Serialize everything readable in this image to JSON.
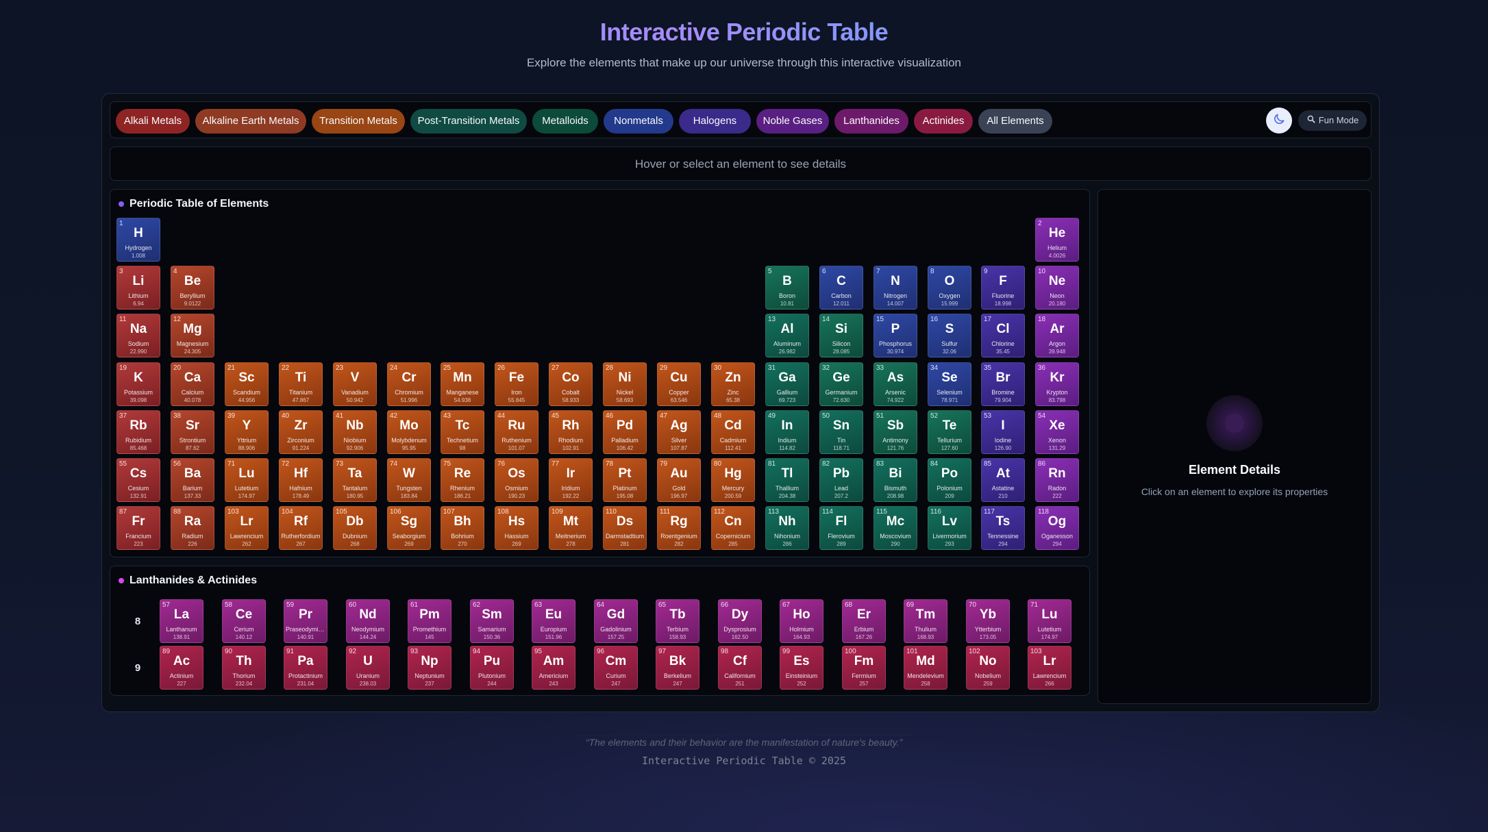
{
  "header": {
    "title": "Interactive Periodic Table",
    "subtitle": "Explore the elements that make up our universe through this interactive visualization"
  },
  "filters": [
    {
      "label": "Alkali Metals",
      "color": "#8f2424"
    },
    {
      "label": "Alkaline Earth Metals",
      "color": "#8f3a23"
    },
    {
      "label": "Transition Metals",
      "color": "#9a4514"
    },
    {
      "label": "Post-Transition Metals",
      "color": "#0f4a43"
    },
    {
      "label": "Metalloids",
      "color": "#0c4a3a"
    },
    {
      "label": "Nonmetals",
      "color": "#233a8c"
    },
    {
      "label": "Halogens",
      "color": "#3a2a8a"
    },
    {
      "label": "Noble Gases",
      "color": "#5a1f82"
    },
    {
      "label": "Lanthanides",
      "color": "#6e1a6a"
    },
    {
      "label": "Actinides",
      "color": "#8a1a40"
    },
    {
      "label": "All Elements",
      "color": "#394355"
    }
  ],
  "toolbar": {
    "theme_icon": "moon-icon",
    "fun_mode_label": "Fun Mode",
    "fun_mode_icon": "magnifier-icon"
  },
  "hover_hint": "Hover or select an element to see details",
  "main_table": {
    "title": "Periodic Table of Elements",
    "dot_color": "#8b5cf6"
  },
  "la_table": {
    "title": "Lanthanides & Actinides",
    "dot_color": "#d946ef",
    "row_labels": [
      "8",
      "9"
    ]
  },
  "details": {
    "title": "Element Details",
    "subtitle": "Click on an element to explore its properties"
  },
  "footer": {
    "quote": "“The elements and their behavior are the manifestation of nature's beauty.”",
    "copyright": "Interactive Periodic Table © 2025"
  },
  "elements": [
    {
      "n": 1,
      "s": "H",
      "name": "Hydrogen",
      "m": "1.008",
      "c": "nonmetal",
      "r": 1,
      "col": 1
    },
    {
      "n": 2,
      "s": "He",
      "name": "Helium",
      "m": "4.0026",
      "c": "noble",
      "r": 1,
      "col": 18
    },
    {
      "n": 3,
      "s": "Li",
      "name": "Lithium",
      "m": "6.94",
      "c": "alkali",
      "r": 2,
      "col": 1
    },
    {
      "n": 4,
      "s": "Be",
      "name": "Beryllium",
      "m": "9.0122",
      "c": "alkaline",
      "r": 2,
      "col": 2
    },
    {
      "n": 5,
      "s": "B",
      "name": "Boron",
      "m": "10.81",
      "c": "metalloid",
      "r": 2,
      "col": 13
    },
    {
      "n": 6,
      "s": "C",
      "name": "Carbon",
      "m": "12.011",
      "c": "nonmetal",
      "r": 2,
      "col": 14
    },
    {
      "n": 7,
      "s": "N",
      "name": "Nitrogen",
      "m": "14.007",
      "c": "nonmetal",
      "r": 2,
      "col": 15
    },
    {
      "n": 8,
      "s": "O",
      "name": "Oxygen",
      "m": "15.999",
      "c": "nonmetal",
      "r": 2,
      "col": 16
    },
    {
      "n": 9,
      "s": "F",
      "name": "Fluorine",
      "m": "18.998",
      "c": "halogen",
      "r": 2,
      "col": 17
    },
    {
      "n": 10,
      "s": "Ne",
      "name": "Neon",
      "m": "20.180",
      "c": "noble",
      "r": 2,
      "col": 18
    },
    {
      "n": 11,
      "s": "Na",
      "name": "Sodium",
      "m": "22.990",
      "c": "alkali",
      "r": 3,
      "col": 1
    },
    {
      "n": 12,
      "s": "Mg",
      "name": "Magnesium",
      "m": "24.305",
      "c": "alkaline",
      "r": 3,
      "col": 2
    },
    {
      "n": 13,
      "s": "Al",
      "name": "Aluminum",
      "m": "26.982",
      "c": "post",
      "r": 3,
      "col": 13
    },
    {
      "n": 14,
      "s": "Si",
      "name": "Silicon",
      "m": "28.085",
      "c": "metalloid",
      "r": 3,
      "col": 14
    },
    {
      "n": 15,
      "s": "P",
      "name": "Phosphorus",
      "m": "30.974",
      "c": "nonmetal",
      "r": 3,
      "col": 15
    },
    {
      "n": 16,
      "s": "S",
      "name": "Sulfur",
      "m": "32.06",
      "c": "nonmetal",
      "r": 3,
      "col": 16
    },
    {
      "n": 17,
      "s": "Cl",
      "name": "Chlorine",
      "m": "35.45",
      "c": "halogen",
      "r": 3,
      "col": 17
    },
    {
      "n": 18,
      "s": "Ar",
      "name": "Argon",
      "m": "39.948",
      "c": "noble",
      "r": 3,
      "col": 18
    },
    {
      "n": 19,
      "s": "K",
      "name": "Potassium",
      "m": "39.098",
      "c": "alkali",
      "r": 4,
      "col": 1
    },
    {
      "n": 20,
      "s": "Ca",
      "name": "Calcium",
      "m": "40.078",
      "c": "alkaline",
      "r": 4,
      "col": 2
    },
    {
      "n": 21,
      "s": "Sc",
      "name": "Scandium",
      "m": "44.956",
      "c": "transition",
      "r": 4,
      "col": 3
    },
    {
      "n": 22,
      "s": "Ti",
      "name": "Titanium",
      "m": "47.867",
      "c": "transition",
      "r": 4,
      "col": 4
    },
    {
      "n": 23,
      "s": "V",
      "name": "Vanadium",
      "m": "50.942",
      "c": "transition",
      "r": 4,
      "col": 5
    },
    {
      "n": 24,
      "s": "Cr",
      "name": "Chromium",
      "m": "51.996",
      "c": "transition",
      "r": 4,
      "col": 6
    },
    {
      "n": 25,
      "s": "Mn",
      "name": "Manganese",
      "m": "54.938",
      "c": "transition",
      "r": 4,
      "col": 7
    },
    {
      "n": 26,
      "s": "Fe",
      "name": "Iron",
      "m": "55.845",
      "c": "transition",
      "r": 4,
      "col": 8
    },
    {
      "n": 27,
      "s": "Co",
      "name": "Cobalt",
      "m": "58.933",
      "c": "transition",
      "r": 4,
      "col": 9
    },
    {
      "n": 28,
      "s": "Ni",
      "name": "Nickel",
      "m": "58.693",
      "c": "transition",
      "r": 4,
      "col": 10
    },
    {
      "n": 29,
      "s": "Cu",
      "name": "Copper",
      "m": "63.546",
      "c": "transition",
      "r": 4,
      "col": 11
    },
    {
      "n": 30,
      "s": "Zn",
      "name": "Zinc",
      "m": "65.38",
      "c": "transition",
      "r": 4,
      "col": 12
    },
    {
      "n": 31,
      "s": "Ga",
      "name": "Gallium",
      "m": "69.723",
      "c": "post",
      "r": 4,
      "col": 13
    },
    {
      "n": 32,
      "s": "Ge",
      "name": "Germanium",
      "m": "72.630",
      "c": "metalloid",
      "r": 4,
      "col": 14
    },
    {
      "n": 33,
      "s": "As",
      "name": "Arsenic",
      "m": "74.922",
      "c": "metalloid",
      "r": 4,
      "col": 15
    },
    {
      "n": 34,
      "s": "Se",
      "name": "Selenium",
      "m": "78.971",
      "c": "nonmetal",
      "r": 4,
      "col": 16
    },
    {
      "n": 35,
      "s": "Br",
      "name": "Bromine",
      "m": "79.904",
      "c": "halogen",
      "r": 4,
      "col": 17
    },
    {
      "n": 36,
      "s": "Kr",
      "name": "Krypton",
      "m": "83.798",
      "c": "noble",
      "r": 4,
      "col": 18
    },
    {
      "n": 37,
      "s": "Rb",
      "name": "Rubidium",
      "m": "85.468",
      "c": "alkali",
      "r": 5,
      "col": 1
    },
    {
      "n": 38,
      "s": "Sr",
      "name": "Strontium",
      "m": "87.62",
      "c": "alkaline",
      "r": 5,
      "col": 2
    },
    {
      "n": 39,
      "s": "Y",
      "name": "Yttrium",
      "m": "88.906",
      "c": "transition",
      "r": 5,
      "col": 3
    },
    {
      "n": 40,
      "s": "Zr",
      "name": "Zirconium",
      "m": "91.224",
      "c": "transition",
      "r": 5,
      "col": 4
    },
    {
      "n": 41,
      "s": "Nb",
      "name": "Niobium",
      "m": "92.906",
      "c": "transition",
      "r": 5,
      "col": 5
    },
    {
      "n": 42,
      "s": "Mo",
      "name": "Molybdenum",
      "m": "95.95",
      "c": "transition",
      "r": 5,
      "col": 6
    },
    {
      "n": 43,
      "s": "Tc",
      "name": "Technetium",
      "m": "98",
      "c": "transition",
      "r": 5,
      "col": 7
    },
    {
      "n": 44,
      "s": "Ru",
      "name": "Ruthenium",
      "m": "101.07",
      "c": "transition",
      "r": 5,
      "col": 8
    },
    {
      "n": 45,
      "s": "Rh",
      "name": "Rhodium",
      "m": "102.91",
      "c": "transition",
      "r": 5,
      "col": 9
    },
    {
      "n": 46,
      "s": "Pd",
      "name": "Palladium",
      "m": "106.42",
      "c": "transition",
      "r": 5,
      "col": 10
    },
    {
      "n": 47,
      "s": "Ag",
      "name": "Silver",
      "m": "107.87",
      "c": "transition",
      "r": 5,
      "col": 11
    },
    {
      "n": 48,
      "s": "Cd",
      "name": "Cadmium",
      "m": "112.41",
      "c": "transition",
      "r": 5,
      "col": 12
    },
    {
      "n": 49,
      "s": "In",
      "name": "Indium",
      "m": "114.82",
      "c": "post",
      "r": 5,
      "col": 13
    },
    {
      "n": 50,
      "s": "Sn",
      "name": "Tin",
      "m": "118.71",
      "c": "post",
      "r": 5,
      "col": 14
    },
    {
      "n": 51,
      "s": "Sb",
      "name": "Antimony",
      "m": "121.76",
      "c": "metalloid",
      "r": 5,
      "col": 15
    },
    {
      "n": 52,
      "s": "Te",
      "name": "Tellurium",
      "m": "127.60",
      "c": "metalloid",
      "r": 5,
      "col": 16
    },
    {
      "n": 53,
      "s": "I",
      "name": "Iodine",
      "m": "126.90",
      "c": "halogen",
      "r": 5,
      "col": 17
    },
    {
      "n": 54,
      "s": "Xe",
      "name": "Xenon",
      "m": "131.29",
      "c": "noble",
      "r": 5,
      "col": 18
    },
    {
      "n": 55,
      "s": "Cs",
      "name": "Cesium",
      "m": "132.91",
      "c": "alkali",
      "r": 6,
      "col": 1
    },
    {
      "n": 56,
      "s": "Ba",
      "name": "Barium",
      "m": "137.33",
      "c": "alkaline",
      "r": 6,
      "col": 2
    },
    {
      "n": 71,
      "s": "Lu",
      "name": "Lutetium",
      "m": "174.97",
      "c": "transition",
      "r": 6,
      "col": 3
    },
    {
      "n": 72,
      "s": "Hf",
      "name": "Hafnium",
      "m": "178.49",
      "c": "transition",
      "r": 6,
      "col": 4
    },
    {
      "n": 73,
      "s": "Ta",
      "name": "Tantalum",
      "m": "180.95",
      "c": "transition",
      "r": 6,
      "col": 5
    },
    {
      "n": 74,
      "s": "W",
      "name": "Tungsten",
      "m": "183.84",
      "c": "transition",
      "r": 6,
      "col": 6
    },
    {
      "n": 75,
      "s": "Re",
      "name": "Rhenium",
      "m": "186.21",
      "c": "transition",
      "r": 6,
      "col": 7
    },
    {
      "n": 76,
      "s": "Os",
      "name": "Osmium",
      "m": "190.23",
      "c": "transition",
      "r": 6,
      "col": 8
    },
    {
      "n": 77,
      "s": "Ir",
      "name": "Iridium",
      "m": "192.22",
      "c": "transition",
      "r": 6,
      "col": 9
    },
    {
      "n": 78,
      "s": "Pt",
      "name": "Platinum",
      "m": "195.08",
      "c": "transition",
      "r": 6,
      "col": 10
    },
    {
      "n": 79,
      "s": "Au",
      "name": "Gold",
      "m": "196.97",
      "c": "transition",
      "r": 6,
      "col": 11
    },
    {
      "n": 80,
      "s": "Hg",
      "name": "Mercury",
      "m": "200.59",
      "c": "transition",
      "r": 6,
      "col": 12
    },
    {
      "n": 81,
      "s": "Tl",
      "name": "Thallium",
      "m": "204.38",
      "c": "post",
      "r": 6,
      "col": 13
    },
    {
      "n": 82,
      "s": "Pb",
      "name": "Lead",
      "m": "207.2",
      "c": "post",
      "r": 6,
      "col": 14
    },
    {
      "n": 83,
      "s": "Bi",
      "name": "Bismuth",
      "m": "208.98",
      "c": "post",
      "r": 6,
      "col": 15
    },
    {
      "n": 84,
      "s": "Po",
      "name": "Polonium",
      "m": "209",
      "c": "post",
      "r": 6,
      "col": 16
    },
    {
      "n": 85,
      "s": "At",
      "name": "Astatine",
      "m": "210",
      "c": "halogen",
      "r": 6,
      "col": 17
    },
    {
      "n": 86,
      "s": "Rn",
      "name": "Radon",
      "m": "222",
      "c": "noble",
      "r": 6,
      "col": 18
    },
    {
      "n": 87,
      "s": "Fr",
      "name": "Francium",
      "m": "223",
      "c": "alkali",
      "r": 7,
      "col": 1
    },
    {
      "n": 88,
      "s": "Ra",
      "name": "Radium",
      "m": "226",
      "c": "alkaline",
      "r": 7,
      "col": 2
    },
    {
      "n": 103,
      "s": "Lr",
      "name": "Lawrencium",
      "m": "262",
      "c": "transition",
      "r": 7,
      "col": 3
    },
    {
      "n": 104,
      "s": "Rf",
      "name": "Rutherfordium",
      "m": "267",
      "c": "transition",
      "r": 7,
      "col": 4
    },
    {
      "n": 105,
      "s": "Db",
      "name": "Dubnium",
      "m": "268",
      "c": "transition",
      "r": 7,
      "col": 5
    },
    {
      "n": 106,
      "s": "Sg",
      "name": "Seaborgium",
      "m": "269",
      "c": "transition",
      "r": 7,
      "col": 6
    },
    {
      "n": 107,
      "s": "Bh",
      "name": "Bohrium",
      "m": "270",
      "c": "transition",
      "r": 7,
      "col": 7
    },
    {
      "n": 108,
      "s": "Hs",
      "name": "Hassium",
      "m": "269",
      "c": "transition",
      "r": 7,
      "col": 8
    },
    {
      "n": 109,
      "s": "Mt",
      "name": "Meitnerium",
      "m": "278",
      "c": "transition",
      "r": 7,
      "col": 9
    },
    {
      "n": 110,
      "s": "Ds",
      "name": "Darmstadtium",
      "m": "281",
      "c": "transition",
      "r": 7,
      "col": 10
    },
    {
      "n": 111,
      "s": "Rg",
      "name": "Roentgenium",
      "m": "282",
      "c": "transition",
      "r": 7,
      "col": 11
    },
    {
      "n": 112,
      "s": "Cn",
      "name": "Copernicium",
      "m": "285",
      "c": "transition",
      "r": 7,
      "col": 12
    },
    {
      "n": 113,
      "s": "Nh",
      "name": "Nihonium",
      "m": "286",
      "c": "post",
      "r": 7,
      "col": 13
    },
    {
      "n": 114,
      "s": "Fl",
      "name": "Flerovium",
      "m": "289",
      "c": "post",
      "r": 7,
      "col": 14
    },
    {
      "n": 115,
      "s": "Mc",
      "name": "Moscovium",
      "m": "290",
      "c": "post",
      "r": 7,
      "col": 15
    },
    {
      "n": 116,
      "s": "Lv",
      "name": "Livermorium",
      "m": "293",
      "c": "post",
      "r": 7,
      "col": 16
    },
    {
      "n": 117,
      "s": "Ts",
      "name": "Tennessine",
      "m": "294",
      "c": "halogen",
      "r": 7,
      "col": 17
    },
    {
      "n": 118,
      "s": "Og",
      "name": "Oganesson",
      "m": "294",
      "c": "noble",
      "r": 7,
      "col": 18
    }
  ],
  "lanthanides": [
    {
      "n": 57,
      "s": "La",
      "name": "Lanthanum",
      "m": "138.91"
    },
    {
      "n": 58,
      "s": "Ce",
      "name": "Cerium",
      "m": "140.12"
    },
    {
      "n": 59,
      "s": "Pr",
      "name": "Praseodymium",
      "m": "140.91"
    },
    {
      "n": 60,
      "s": "Nd",
      "name": "Neodymium",
      "m": "144.24"
    },
    {
      "n": 61,
      "s": "Pm",
      "name": "Promethium",
      "m": "145"
    },
    {
      "n": 62,
      "s": "Sm",
      "name": "Samarium",
      "m": "150.36"
    },
    {
      "n": 63,
      "s": "Eu",
      "name": "Europium",
      "m": "151.96"
    },
    {
      "n": 64,
      "s": "Gd",
      "name": "Gadolinium",
      "m": "157.25"
    },
    {
      "n": 65,
      "s": "Tb",
      "name": "Terbium",
      "m": "158.93"
    },
    {
      "n": 66,
      "s": "Dy",
      "name": "Dysprosium",
      "m": "162.50"
    },
    {
      "n": 67,
      "s": "Ho",
      "name": "Holmium",
      "m": "164.93"
    },
    {
      "n": 68,
      "s": "Er",
      "name": "Erbium",
      "m": "167.26"
    },
    {
      "n": 69,
      "s": "Tm",
      "name": "Thulium",
      "m": "168.93"
    },
    {
      "n": 70,
      "s": "Yb",
      "name": "Ytterbium",
      "m": "173.05"
    },
    {
      "n": 71,
      "s": "Lu",
      "name": "Lutetium",
      "m": "174.97"
    }
  ],
  "actinides": [
    {
      "n": 89,
      "s": "Ac",
      "name": "Actinium",
      "m": "227"
    },
    {
      "n": 90,
      "s": "Th",
      "name": "Thorium",
      "m": "232.04"
    },
    {
      "n": 91,
      "s": "Pa",
      "name": "Protactinium",
      "m": "231.04"
    },
    {
      "n": 92,
      "s": "U",
      "name": "Uranium",
      "m": "238.03"
    },
    {
      "n": 93,
      "s": "Np",
      "name": "Neptunium",
      "m": "237"
    },
    {
      "n": 94,
      "s": "Pu",
      "name": "Plutonium",
      "m": "244"
    },
    {
      "n": 95,
      "s": "Am",
      "name": "Americium",
      "m": "243"
    },
    {
      "n": 96,
      "s": "Cm",
      "name": "Curium",
      "m": "247"
    },
    {
      "n": 97,
      "s": "Bk",
      "name": "Berkelium",
      "m": "247"
    },
    {
      "n": 98,
      "s": "Cf",
      "name": "Californium",
      "m": "251"
    },
    {
      "n": 99,
      "s": "Es",
      "name": "Einsteinium",
      "m": "252"
    },
    {
      "n": 100,
      "s": "Fm",
      "name": "Fermium",
      "m": "257"
    },
    {
      "n": 101,
      "s": "Md",
      "name": "Mendelevium",
      "m": "258"
    },
    {
      "n": 102,
      "s": "No",
      "name": "Nobelium",
      "m": "259"
    },
    {
      "n": 103,
      "s": "Lr",
      "name": "Lawrencium",
      "m": "266"
    }
  ]
}
